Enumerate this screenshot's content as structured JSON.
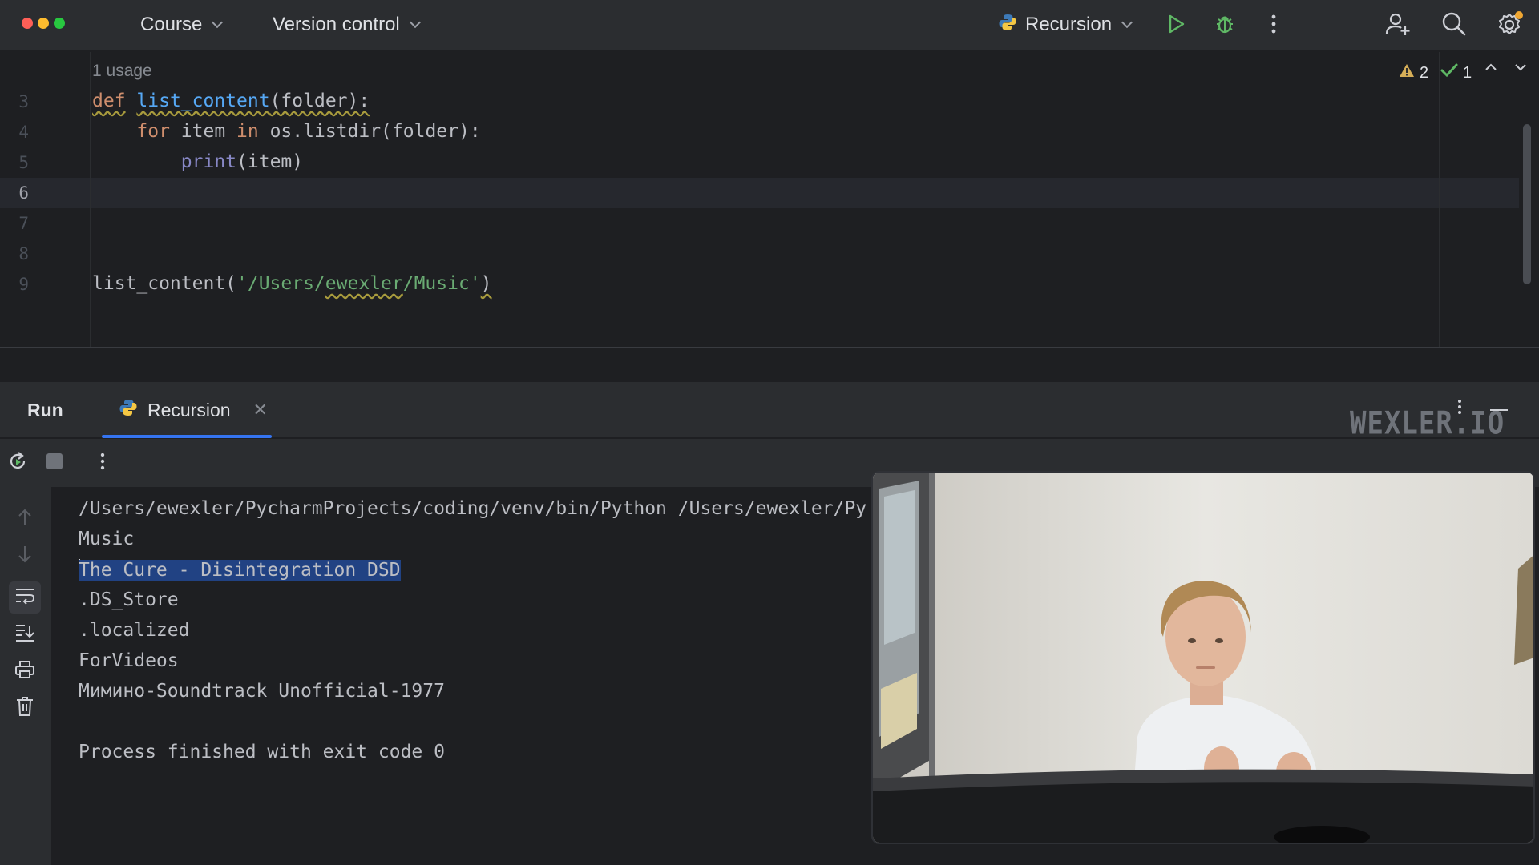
{
  "titlebar": {
    "menus": [
      {
        "label": "Course"
      },
      {
        "label": "Version control"
      }
    ],
    "run_config": "Recursion"
  },
  "editor": {
    "usage_hint": "1 usage",
    "line_numbers": [
      "3",
      "4",
      "5",
      "6",
      "7",
      "8",
      "9"
    ],
    "current_line": "6",
    "code": {
      "l3_kw": "def",
      "l3_fn": "list_content",
      "l3_rest": "(folder):",
      "l4_for": "for",
      "l4_item": " item ",
      "l4_in": "in",
      "l4_rest": " os.listdir(folder):",
      "l5_print": "print",
      "l5_rest": "(item)",
      "l9_call": "list_content(",
      "l9_str_a": "'/Users/",
      "l9_str_b": "ewexler",
      "l9_str_c": "/Music'",
      "l9_close": ")"
    },
    "inspections": {
      "warnings": "2",
      "ok": "1"
    }
  },
  "run_panel": {
    "title": "Run",
    "tab_label": "Recursion",
    "watermark": "WEXLER.IO",
    "console_lines": [
      "/Users/ewexler/PycharmProjects/coding/venv/bin/Python /Users/ewexler/Py",
      "Music",
      "The Cure - Disintegration DSD",
      ".DS_Store",
      ".localized",
      "ForVideos",
      "Мимино-Soundtrack Unofficial-1977",
      "",
      "Process finished with exit code 0"
    ]
  },
  "colors": {
    "accent": "#3574f0",
    "keyword": "#cf8e6d",
    "function": "#56a8f5",
    "string": "#6aab73",
    "run_green": "#5fb865",
    "selection": "#214283"
  },
  "icons": [
    "python-icon",
    "run-icon",
    "debug-icon",
    "more-icon",
    "add-user-icon",
    "search-icon",
    "settings-icon",
    "rerun-icon",
    "stop-icon",
    "up-arrow-icon",
    "down-arrow-icon",
    "soft-wrap-icon",
    "scroll-to-end-icon",
    "print-icon",
    "trash-icon"
  ]
}
